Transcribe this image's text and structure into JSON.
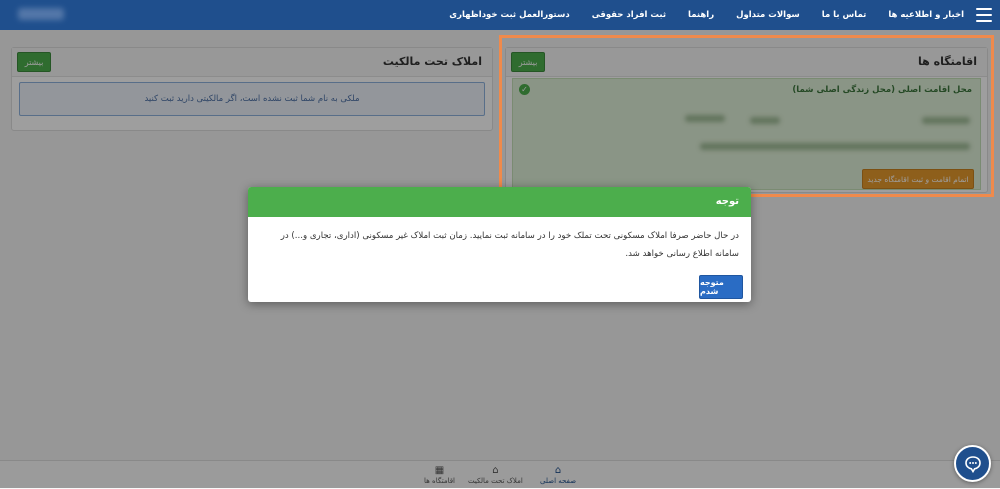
{
  "navbar": {
    "links": [
      "اخبار و اطلاعیه ها",
      "تماس با ما",
      "سوالات متداول",
      "راهنما",
      "ثبت افراد حقوقی",
      "دستورالعمل ثبت خوداظهاری"
    ],
    "menu_icon": "hamburger-icon"
  },
  "properties_panel": {
    "title": "املاک تحت مالکیت",
    "more_label": "بیشتر",
    "notice": "ملکی به نام شما ثبت نشده است، اگر مالکیتی دارید ثبت کنید"
  },
  "residences_panel": {
    "title": "اقامتگاه ها",
    "more_label": "بیشتر",
    "main_residence_title": "محل اقامت اصلی (محل زندگی اصلی شما)",
    "complete_button": "اتمام اقامت و ثبت اقامتگاه جدید",
    "check_icon": "check-circle-icon"
  },
  "modal": {
    "title": "توجه",
    "body": "در حال حاضر صرفا املاک مسکونی تحت تملک خود را در سامانه ثبت نمایید. زمان ثبت املاک غیر مسکونی (اداری، تجاری و...) در سامانه اطلاع رسانی خواهد شد.",
    "ok_button": "متوجه شدم"
  },
  "bottom_nav": [
    {
      "label": "صفحه اصلی",
      "icon": "home-icon",
      "active": true
    },
    {
      "label": "املاک تحت مالکیت",
      "icon": "home-icon",
      "active": false
    },
    {
      "label": "اقامتگاه ها",
      "icon": "building-icon",
      "active": false
    }
  ],
  "colors": {
    "navbar": "#1f4f8d",
    "success": "#4cae4c",
    "warning": "#e69a2d",
    "primary": "#2a6cc4",
    "highlight": "#f08a4b"
  }
}
